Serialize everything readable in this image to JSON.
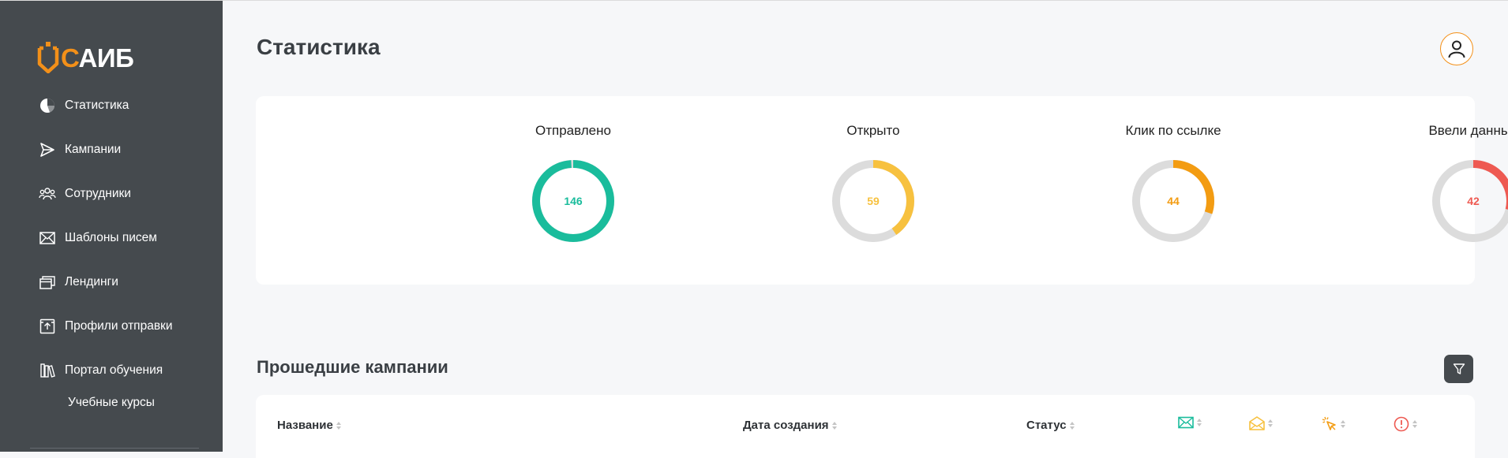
{
  "brand": {
    "logo_c": "С",
    "logo_rest": "АИБ",
    "accent": "#f39019"
  },
  "sidebar": {
    "items": [
      {
        "label": "Статистика",
        "icon": "pie-chart-icon"
      },
      {
        "label": "Кампании",
        "icon": "paper-plane-icon"
      },
      {
        "label": "Сотрудники",
        "icon": "users-icon"
      },
      {
        "label": "Шаблоны писем",
        "icon": "envelope-icon"
      },
      {
        "label": "Лендинги",
        "icon": "windows-icon"
      },
      {
        "label": "Профили отправки",
        "icon": "upload-box-icon"
      },
      {
        "label": "Портал обучения",
        "icon": "books-icon"
      }
    ],
    "sub_items": [
      {
        "label": "Учебные курсы"
      }
    ]
  },
  "header": {
    "title": "Статистика",
    "avatar_icon": "user-icon"
  },
  "stats": [
    {
      "label": "Отправлено",
      "value": 146,
      "fraction": 0.99,
      "color": "#1abc9c"
    },
    {
      "label": "Открыто",
      "value": 59,
      "fraction": 0.404,
      "color": "#f7c13f"
    },
    {
      "label": "Клик по ссылке",
      "value": 44,
      "fraction": 0.301,
      "color": "#f39c12"
    },
    {
      "label": "Ввели данные",
      "value": 42,
      "fraction": 0.288,
      "color": "#ee5a52"
    }
  ],
  "campaigns": {
    "title": "Прошедшие кампании",
    "filter_icon": "filter-icon",
    "columns": [
      {
        "label": "Название"
      },
      {
        "label": "Дата создания"
      },
      {
        "label": "Статус"
      }
    ],
    "icon_columns": [
      {
        "icon": "envelope-icon",
        "color": "#1abc9c"
      },
      {
        "icon": "open-envelope-icon",
        "color": "#f7c13f"
      },
      {
        "icon": "cursor-click-icon",
        "color": "#f39c12"
      },
      {
        "icon": "alert-circle-icon",
        "color": "#ee5a52"
      }
    ]
  }
}
